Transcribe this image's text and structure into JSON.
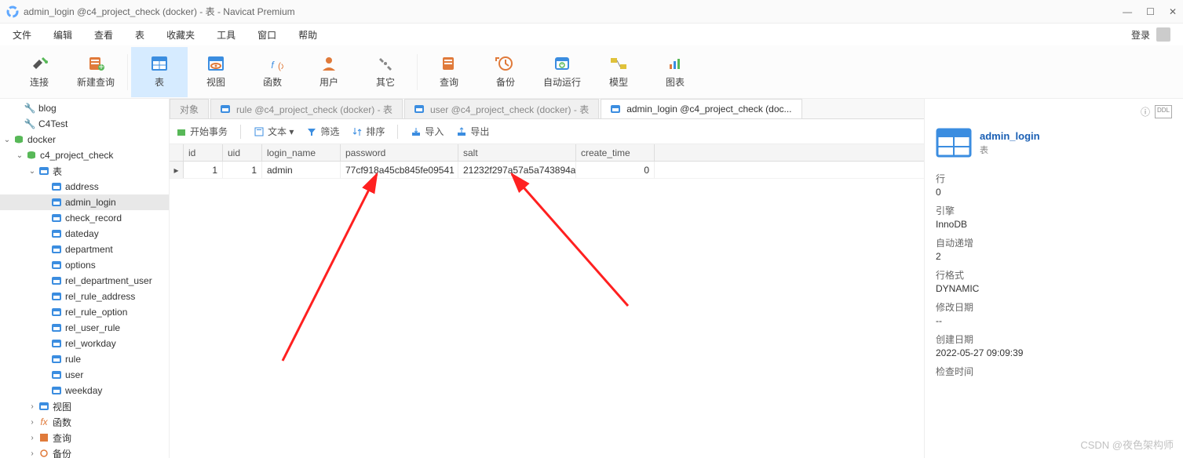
{
  "window": {
    "title": "admin_login @c4_project_check (docker) - 表 - Navicat Premium"
  },
  "menu": {
    "items": [
      "文件",
      "编辑",
      "查看",
      "表",
      "收藏夹",
      "工具",
      "窗口",
      "帮助"
    ],
    "login": "登录"
  },
  "toolbar": {
    "items": [
      {
        "label": "连接",
        "icon": "plug"
      },
      {
        "label": "新建查询",
        "icon": "sheet"
      },
      {
        "label": "表",
        "icon": "table",
        "active": true
      },
      {
        "label": "视图",
        "icon": "view"
      },
      {
        "label": "函数",
        "icon": "fx"
      },
      {
        "label": "用户",
        "icon": "user"
      },
      {
        "label": "其它",
        "icon": "wrench"
      },
      {
        "label": "查询",
        "icon": "query"
      },
      {
        "label": "备份",
        "icon": "backup"
      },
      {
        "label": "自动运行",
        "icon": "clock"
      },
      {
        "label": "模型",
        "icon": "model"
      },
      {
        "label": "图表",
        "icon": "chart"
      }
    ]
  },
  "tree": {
    "blog": "blog",
    "c4test": "C4Test",
    "docker": "docker",
    "c4pc": "c4_project_check",
    "biao": "表",
    "tables": [
      "address",
      "admin_login",
      "check_record",
      "dateday",
      "department",
      "options",
      "rel_department_user",
      "rel_rule_address",
      "rel_rule_option",
      "rel_user_rule",
      "rel_workday",
      "rule",
      "user",
      "weekday"
    ],
    "shitu": "视图",
    "hanshu": "函数",
    "chaxun": "查询",
    "beifen": "备份"
  },
  "tabs": {
    "items": [
      {
        "label": "对象"
      },
      {
        "label": "rule @c4_project_check (docker) - 表"
      },
      {
        "label": "user @c4_project_check (docker) - 表"
      },
      {
        "label": "admin_login @c4_project_check (doc...",
        "active": true
      }
    ]
  },
  "subtoolbar": {
    "start": "开始事务",
    "text": "文本 ▾",
    "filter": "筛选",
    "sort": "排序",
    "import": "导入",
    "export": "导出"
  },
  "grid": {
    "columns": [
      "id",
      "uid",
      "login_name",
      "password",
      "salt",
      "create_time"
    ],
    "widths": [
      50,
      50,
      100,
      150,
      150,
      100
    ],
    "rows": [
      {
        "id": "1",
        "uid": "1",
        "login_name": "admin",
        "password": "77cf918a45cb845fe09541",
        "salt": "21232f297a57a5a743894a",
        "create_time": "0"
      }
    ]
  },
  "info": {
    "name": "admin_login",
    "type": "表",
    "fields": [
      {
        "label": "行",
        "value": "0"
      },
      {
        "label": "引擎",
        "value": "InnoDB"
      },
      {
        "label": "自动递增",
        "value": "2"
      },
      {
        "label": "行格式",
        "value": "DYNAMIC"
      },
      {
        "label": "修改日期",
        "value": "--"
      },
      {
        "label": "创建日期",
        "value": "2022-05-27 09:09:39"
      },
      {
        "label": "检查时间",
        "value": ""
      }
    ]
  },
  "watermark": "CSDN @夜色架构师"
}
